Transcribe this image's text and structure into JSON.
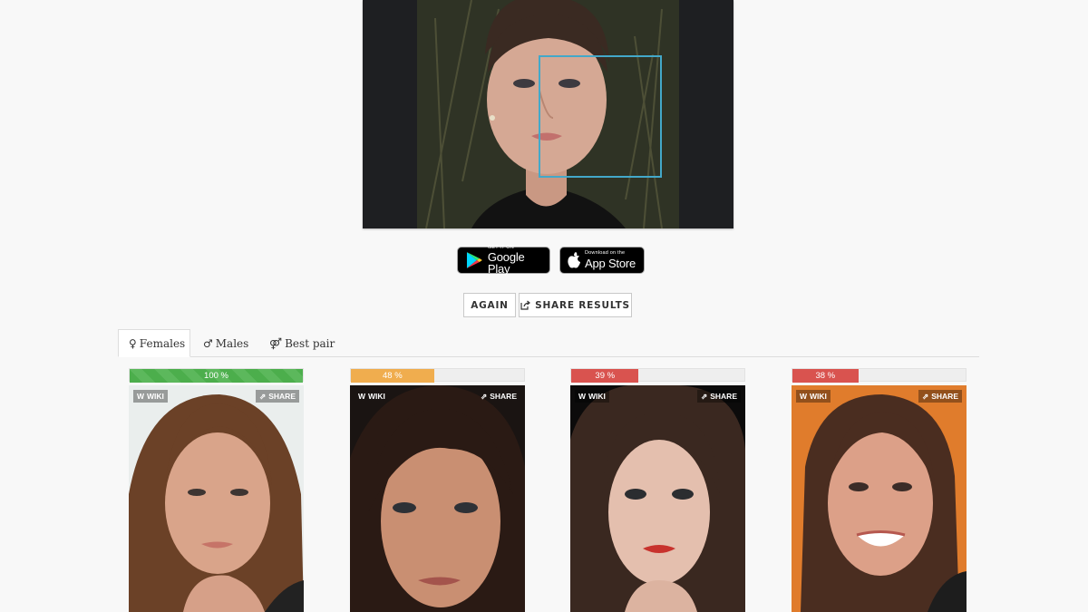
{
  "upload": {
    "face_box_color": "#43a8c9"
  },
  "stores": {
    "google_play": {
      "small": "GET IT ON",
      "big": "Google Play"
    },
    "app_store": {
      "small": "Download on the",
      "big": "App Store"
    }
  },
  "actions": {
    "again": "AGAIN",
    "share": "SHARE RESULTS"
  },
  "tabs": [
    {
      "label": "Females",
      "icon": "female-icon",
      "active": true
    },
    {
      "label": "Males",
      "icon": "male-icon",
      "active": false
    },
    {
      "label": "Best pair",
      "icon": "pair-icon",
      "active": false
    }
  ],
  "results": [
    {
      "percent_label": "100 %",
      "percent": 100,
      "color": "#5cb85c",
      "wiki": "WIKI",
      "share": "SHARE"
    },
    {
      "percent_label": "48 %",
      "percent": 48,
      "color": "#f0ad4e",
      "wiki": "WIKI",
      "share": "SHARE"
    },
    {
      "percent_label": "39 %",
      "percent": 39,
      "color": "#d9534f",
      "wiki": "WIKI",
      "share": "SHARE"
    },
    {
      "percent_label": "38 %",
      "percent": 38,
      "color": "#d9534f",
      "wiki": "WIKI",
      "share": "SHARE"
    }
  ]
}
